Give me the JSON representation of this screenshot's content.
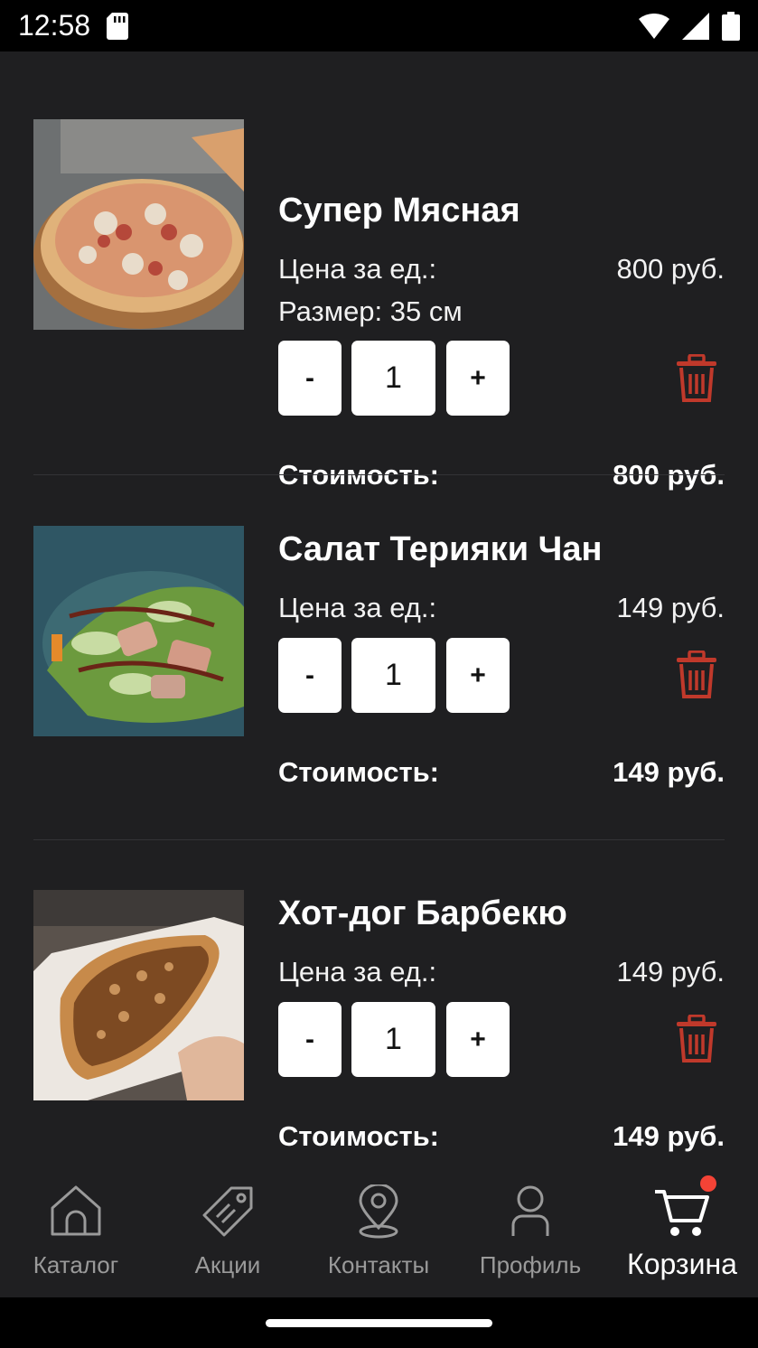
{
  "status_bar": {
    "time": "12:58"
  },
  "cart": {
    "items": [
      {
        "name": "Супер Мясная",
        "price_label": "Цена за ед.:",
        "price": "800 руб.",
        "size_label": "Размер: 35 см",
        "minus": "-",
        "quantity": "1",
        "plus": "+",
        "total_label": "Стоимость:",
        "total": "800 руб.",
        "image": "pizza-photo"
      },
      {
        "name": "Салат Терияки Чан",
        "price_label": "Цена за ед.:",
        "price": "149 руб.",
        "minus": "-",
        "quantity": "1",
        "plus": "+",
        "total_label": "Стоимость:",
        "total": "149 руб.",
        "image": "salad-photo"
      },
      {
        "name": "Хот-дог Барбекю",
        "price_label": "Цена за ед.:",
        "price": "149 руб.",
        "minus": "-",
        "quantity": "1",
        "plus": "+",
        "total_label": "Стоимость:",
        "total": "149 руб.",
        "image": "hotdog-photo"
      }
    ]
  },
  "bottom_nav": {
    "items": [
      {
        "label": "Каталог",
        "icon": "home-icon"
      },
      {
        "label": "Акции",
        "icon": "tag-icon"
      },
      {
        "label": "Контакты",
        "icon": "location-pin-icon"
      },
      {
        "label": "Профиль",
        "icon": "user-icon"
      },
      {
        "label": "Корзина",
        "icon": "cart-icon",
        "active": true,
        "badge": true
      }
    ]
  },
  "colors": {
    "background": "#1f1f21",
    "delete": "#c0392b",
    "badge": "#f44336",
    "inactive_nav": "#9a9a9a"
  }
}
